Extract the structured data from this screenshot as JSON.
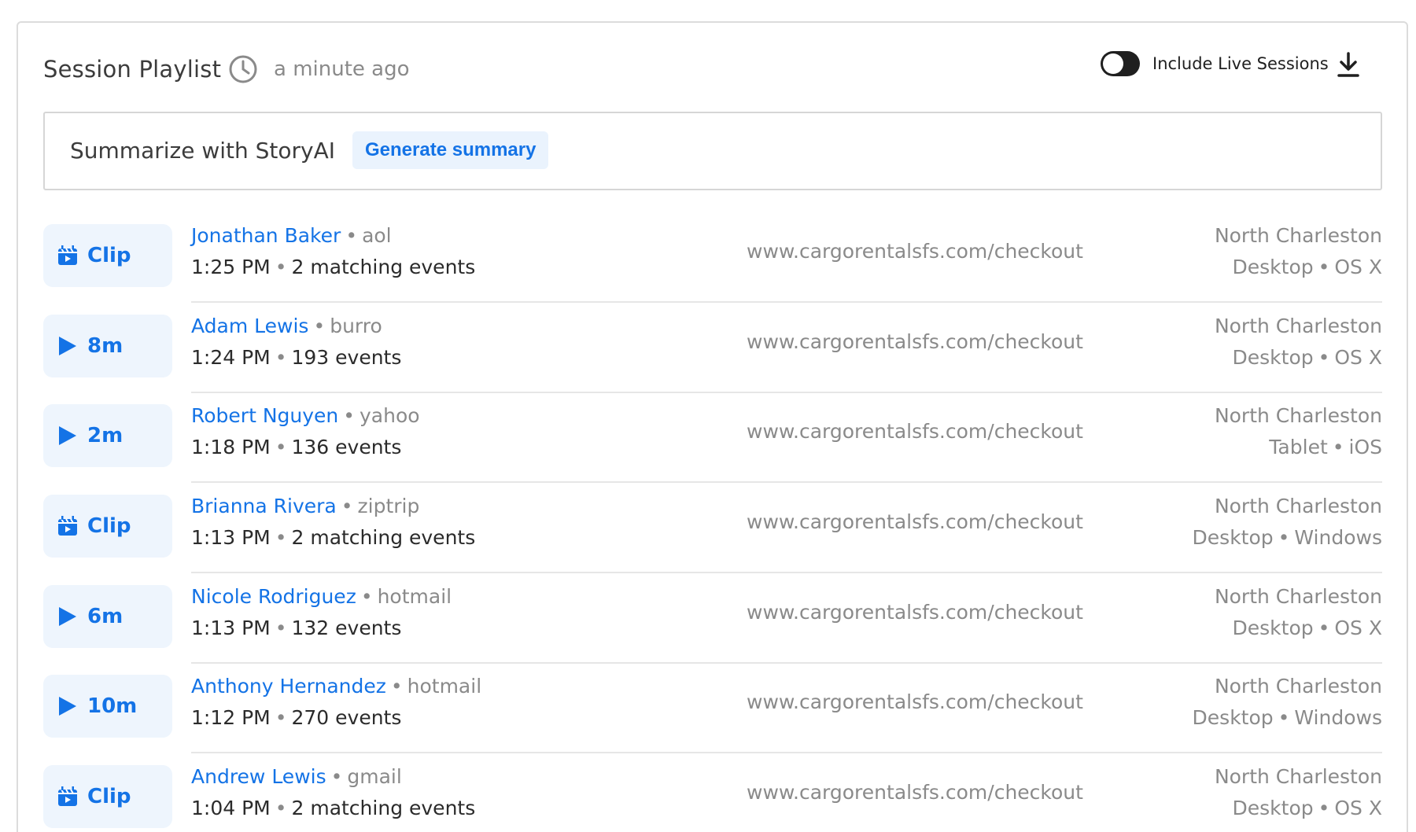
{
  "header": {
    "title": "Session Playlist",
    "time_ago": "a minute ago",
    "toggle_label": "Include Live Sessions",
    "toggle_on": true
  },
  "summary": {
    "label": "Summarize with StoryAI",
    "button_label": "Generate summary"
  },
  "colors": {
    "accent": "#1473e6",
    "button_bg": "#eef5fd",
    "muted": "#8a8a8a"
  },
  "sessions": [
    {
      "play_type": "clip",
      "play_label": "Clip",
      "user": "Jonathan Baker",
      "provider": "aol",
      "time": "1:25 PM",
      "events": "2 matching events",
      "url": "www.cargorentalsfs.com/checkout",
      "location": "North Charleston",
      "device": "Desktop",
      "os": "OS X"
    },
    {
      "play_type": "play",
      "play_label": "8m",
      "user": "Adam Lewis",
      "provider": "burro",
      "time": "1:24 PM",
      "events": "193 events",
      "url": "www.cargorentalsfs.com/checkout",
      "location": "North Charleston",
      "device": "Desktop",
      "os": "OS X"
    },
    {
      "play_type": "play",
      "play_label": "2m",
      "user": "Robert Nguyen",
      "provider": "yahoo",
      "time": "1:18 PM",
      "events": "136 events",
      "url": "www.cargorentalsfs.com/checkout",
      "location": "North Charleston",
      "device": "Tablet",
      "os": "iOS"
    },
    {
      "play_type": "clip",
      "play_label": "Clip",
      "user": "Brianna Rivera",
      "provider": "ziptrip",
      "time": "1:13 PM",
      "events": "2 matching events",
      "url": "www.cargorentalsfs.com/checkout",
      "location": "North Charleston",
      "device": "Desktop",
      "os": "Windows"
    },
    {
      "play_type": "play",
      "play_label": "6m",
      "user": "Nicole Rodriguez",
      "provider": "hotmail",
      "time": "1:13 PM",
      "events": "132 events",
      "url": "www.cargorentalsfs.com/checkout",
      "location": "North Charleston",
      "device": "Desktop",
      "os": "OS X"
    },
    {
      "play_type": "play",
      "play_label": "10m",
      "user": "Anthony Hernandez",
      "provider": "hotmail",
      "time": "1:12 PM",
      "events": "270 events",
      "url": "www.cargorentalsfs.com/checkout",
      "location": "North Charleston",
      "device": "Desktop",
      "os": "Windows"
    },
    {
      "play_type": "clip",
      "play_label": "Clip",
      "user": "Andrew Lewis",
      "provider": "gmail",
      "time": "1:04 PM",
      "events": "2 matching events",
      "url": "www.cargorentalsfs.com/checkout",
      "location": "North Charleston",
      "device": "Desktop",
      "os": "OS X"
    }
  ]
}
